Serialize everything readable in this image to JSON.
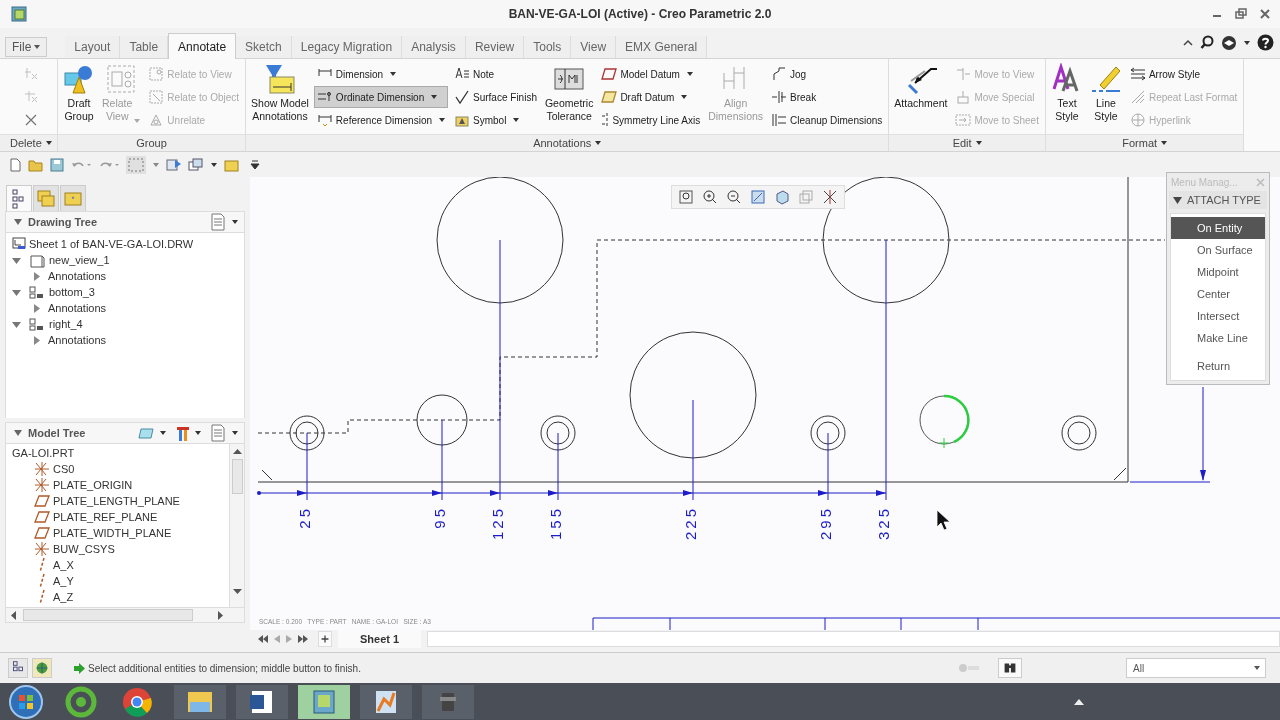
{
  "window": {
    "title": "BAN-VE-GA-LOI (Active) - Creo Parametric 2.0"
  },
  "file_menu": {
    "label": "File"
  },
  "tabs": [
    {
      "label": "Layout",
      "selected": false
    },
    {
      "label": "Table",
      "selected": false
    },
    {
      "label": "Annotate",
      "selected": true
    },
    {
      "label": "Sketch",
      "selected": false
    },
    {
      "label": "Legacy Migration",
      "selected": false
    },
    {
      "label": "Analysis",
      "selected": false
    },
    {
      "label": "Review",
      "selected": false
    },
    {
      "label": "Tools",
      "selected": false
    },
    {
      "label": "View",
      "selected": false
    },
    {
      "label": "EMX General",
      "selected": false
    }
  ],
  "ribbon": {
    "groups": [
      {
        "label": "Delete",
        "dropdown": true,
        "items": [
          {
            "kind": "column",
            "commands": [
              {
                "kind": "icon",
                "disabled": true
              },
              {
                "kind": "icon",
                "disabled": true
              },
              {
                "kind": "icon",
                "disabled": false
              }
            ]
          }
        ]
      },
      {
        "label": "Group",
        "dropdown": false,
        "items": [
          {
            "kind": "large",
            "label": "Draft\nGroup",
            "disabled": false,
            "dropdown": false
          },
          {
            "kind": "large",
            "label": "Relate\nView",
            "disabled": true,
            "dropdown": true
          },
          {
            "kind": "column",
            "commands": [
              {
                "kind": "small",
                "label": "Relate to View",
                "disabled": true,
                "dropdown": false,
                "pressed": false
              },
              {
                "kind": "small",
                "label": "Relate to Object",
                "disabled": true,
                "dropdown": false,
                "pressed": false
              },
              {
                "kind": "small",
                "label": "Unrelate",
                "disabled": true,
                "dropdown": false,
                "pressed": false
              }
            ]
          }
        ]
      },
      {
        "label": "Annotations",
        "dropdown": true,
        "items": [
          {
            "kind": "large",
            "label": "Show Model\nAnnotations",
            "disabled": false,
            "dropdown": false
          },
          {
            "kind": "column",
            "commands": [
              {
                "kind": "small",
                "label": "Dimension",
                "disabled": false,
                "dropdown": true,
                "pressed": false
              },
              {
                "kind": "small",
                "label": "Ordinate Dimension",
                "disabled": false,
                "dropdown": true,
                "pressed": true
              },
              {
                "kind": "small",
                "label": "Reference Dimension",
                "disabled": false,
                "dropdown": true,
                "pressed": false
              }
            ]
          },
          {
            "kind": "column",
            "commands": [
              {
                "kind": "small",
                "label": "Note",
                "disabled": false,
                "dropdown": false,
                "pressed": false
              },
              {
                "kind": "small",
                "label": "Surface Finish",
                "disabled": false,
                "dropdown": false,
                "pressed": false
              },
              {
                "kind": "small",
                "label": "Symbol",
                "disabled": false,
                "dropdown": true,
                "pressed": false
              }
            ]
          },
          {
            "kind": "large",
            "label": "Geometric\nTolerance",
            "disabled": false,
            "dropdown": false
          },
          {
            "kind": "column",
            "commands": [
              {
                "kind": "small",
                "label": "Model Datum",
                "disabled": false,
                "dropdown": true,
                "pressed": false
              },
              {
                "kind": "small",
                "label": "Draft Datum",
                "disabled": false,
                "dropdown": true,
                "pressed": false
              },
              {
                "kind": "small",
                "label": "Symmetry Line Axis",
                "disabled": false,
                "dropdown": false,
                "pressed": false
              }
            ]
          },
          {
            "kind": "large",
            "label": "Align\nDimensions",
            "disabled": true,
            "dropdown": false
          },
          {
            "kind": "column",
            "commands": [
              {
                "kind": "small",
                "label": "Jog",
                "disabled": false,
                "dropdown": false,
                "pressed": false
              },
              {
                "kind": "small",
                "label": "Break",
                "disabled": false,
                "dropdown": false,
                "pressed": false
              },
              {
                "kind": "small",
                "label": "Cleanup Dimensions",
                "disabled": false,
                "dropdown": false,
                "pressed": false
              }
            ]
          }
        ]
      },
      {
        "label": "Edit",
        "dropdown": true,
        "items": [
          {
            "kind": "large",
            "label": "Attachment",
            "disabled": false,
            "dropdown": false
          },
          {
            "kind": "column",
            "commands": [
              {
                "kind": "small",
                "label": "Move to View",
                "disabled": true,
                "dropdown": false,
                "pressed": false
              },
              {
                "kind": "small",
                "label": "Move Special",
                "disabled": true,
                "dropdown": false,
                "pressed": false
              },
              {
                "kind": "small",
                "label": "Move to Sheet",
                "disabled": true,
                "dropdown": false,
                "pressed": false
              }
            ]
          }
        ]
      },
      {
        "label": "Format",
        "dropdown": true,
        "items": [
          {
            "kind": "large",
            "label": "Text\nStyle",
            "disabled": false,
            "dropdown": false
          },
          {
            "kind": "large",
            "label": "Line\nStyle",
            "disabled": false,
            "dropdown": false
          },
          {
            "kind": "column",
            "commands": [
              {
                "kind": "small",
                "label": "Arrow Style",
                "disabled": false,
                "dropdown": false,
                "pressed": false
              },
              {
                "kind": "small",
                "label": "Repeat Last Format",
                "disabled": true,
                "dropdown": false,
                "pressed": false
              },
              {
                "kind": "small",
                "label": "Hyperlink",
                "disabled": true,
                "dropdown": false,
                "pressed": false
              }
            ]
          }
        ]
      }
    ]
  },
  "navigator_tabs": [
    {
      "selected": true
    },
    {
      "selected": false
    },
    {
      "selected": false
    }
  ],
  "drawing_tree": {
    "title": "Drawing Tree",
    "items": [
      {
        "kind": "sheet",
        "label": "Sheet 1 of BAN-VE-GA-LOI.DRW"
      },
      {
        "kind": "general_view",
        "label": "new_view_1",
        "expanded": true,
        "children": [
          {
            "label": "Annotations",
            "expanded": false
          }
        ]
      },
      {
        "kind": "projection_view",
        "label": "bottom_3",
        "expanded": true,
        "children": [
          {
            "label": "Annotations",
            "expanded": false
          }
        ]
      },
      {
        "kind": "projection_view",
        "label": "right_4",
        "expanded": true,
        "children": [
          {
            "label": "Annotations",
            "expanded": false
          }
        ]
      }
    ]
  },
  "model_tree": {
    "title": "Model Tree",
    "items": [
      {
        "kind": "part",
        "label": "GA-LOI.PRT",
        "children": [
          {
            "kind": "csys",
            "label": "CS0"
          },
          {
            "kind": "csys",
            "label": "PLATE_ORIGIN"
          },
          {
            "kind": "plane",
            "label": "PLATE_LENGTH_PLANE"
          },
          {
            "kind": "plane",
            "label": "PLATE_REF_PLANE"
          },
          {
            "kind": "plane",
            "label": "PLATE_WIDTH_PLANE"
          },
          {
            "kind": "csys",
            "label": "BUW_CSYS"
          },
          {
            "kind": "axis",
            "label": "A_X"
          },
          {
            "kind": "axis",
            "label": "A_Y"
          },
          {
            "kind": "axis",
            "label": "A_Z"
          }
        ]
      }
    ]
  },
  "drawing": {
    "ordinate_dimensions": [
      {
        "value": "25"
      },
      {
        "value": "95"
      },
      {
        "value": "125"
      },
      {
        "value": "155"
      },
      {
        "value": "225"
      },
      {
        "value": "295"
      },
      {
        "value": "325"
      }
    ],
    "title_block_note": "SCALE : 0.200   TYPE : PART   NAME : GA-LOI   SIZE : A3"
  },
  "menu_manager": {
    "title": "Menu Manag...",
    "section": "ATTACH TYPE",
    "items": [
      {
        "kind": "option",
        "label": "On Entity",
        "selected": true
      },
      {
        "kind": "option",
        "label": "On Surface",
        "selected": false
      },
      {
        "kind": "option",
        "label": "Midpoint",
        "selected": false
      },
      {
        "kind": "option",
        "label": "Center",
        "selected": false
      },
      {
        "kind": "option",
        "label": "Intersect",
        "selected": false
      },
      {
        "kind": "option",
        "label": "Make Line",
        "selected": false
      },
      {
        "kind": "command",
        "label": "Return",
        "selected": false
      }
    ]
  },
  "sheet_tabs": [
    {
      "label": "Sheet 1",
      "selected": true
    }
  ],
  "status_bar": {
    "message": "Select additional entities to dimension; middle button to finish.",
    "filter": "All"
  }
}
